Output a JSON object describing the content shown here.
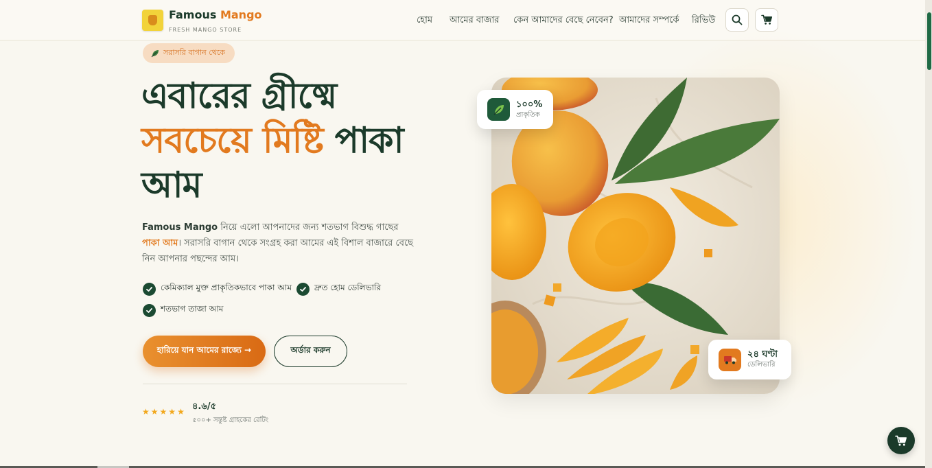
{
  "brand": {
    "name_main": "Famous",
    "name_accent": "Mango",
    "subtitle": "FRESH MANGO STORE"
  },
  "nav": {
    "items": [
      {
        "label": "হোম"
      },
      {
        "label": "আমের বাজার"
      },
      {
        "label": "কেন আমাদের বেছে নেবেন?"
      },
      {
        "label": "আমাদের সম্পর্কে"
      },
      {
        "label": "রিভিউ"
      }
    ],
    "search_icon": "search-icon",
    "cart_icon": "cart-icon"
  },
  "hero": {
    "badge": "সরাসরি বাগান থেকে",
    "title_line1": "এবারের গ্রীষ্মে",
    "title_line2_orange": "সবচেয়ে মিষ্টি",
    "title_line2_dark": "পাকা",
    "title_line3": "আম",
    "description": {
      "brand": "Famous Mango",
      "text1": " নিয়ে এলো আপনাদের জন্য শতভাগ বিশুদ্ধ গাছের ",
      "highlight": "পাকা আম",
      "text2": "। সরাসরি বাগান থেকে সংগ্রহ করা আমের এই বিশাল বাজারে বেছে নিন আপনার পছন্দের আম।"
    },
    "features": [
      "কেমিক্যাল মুক্ত প্রাকৃতিকভাবে পাকা আম",
      "দ্রুত হোম ডেলিভারি",
      "শতভাগ তাজা আম"
    ],
    "primary_button": "হারিয়ে যান আমের রাজ্যে →",
    "secondary_button": "অর্ডার করুন",
    "rating": {
      "value": "৪.৬/৫",
      "subtitle": "৫০০+ সন্তুষ্ট গ্রাহকের রেটিং",
      "stars": 5
    }
  },
  "cards": {
    "natural": {
      "title": "১০০%",
      "subtitle": "প্রাকৃতিক"
    },
    "delivery": {
      "title": "২৪ ঘণ্টা",
      "subtitle": "ডেলিভারি"
    }
  },
  "colors": {
    "accent": "#e27a1f",
    "dark_green": "#1b3a2a",
    "background": "#f9f7f0"
  }
}
